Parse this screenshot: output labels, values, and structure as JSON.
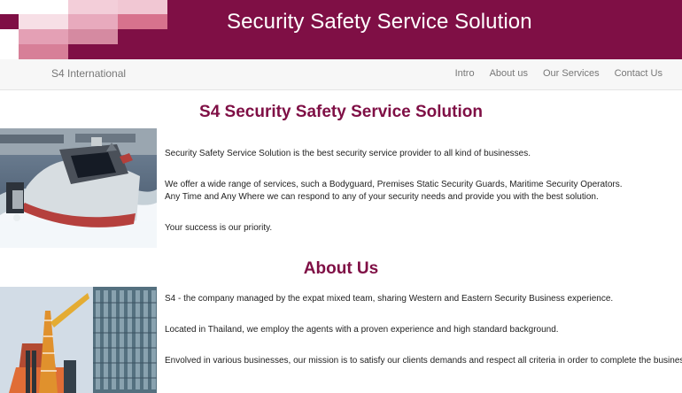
{
  "banner": {
    "title": "Security Safety Service Solution",
    "background_color": "#7f0f45",
    "logo_icon": "pink-mosaic-tiles-icon"
  },
  "navbar": {
    "brand": "S4 International",
    "links": [
      "Intro",
      "About us",
      "Our Services",
      "Contact Us"
    ]
  },
  "intro": {
    "heading": "S4 Security Safety Service Solution",
    "image": "security-boat-photo",
    "paragraphs": [
      "Security Safety Service Solution is the best security service provider to all kind of businesses.",
      "We offer a wide range of services, such a Bodyguard, Premises Static Security Guards, Maritime Security Operators.",
      "Any Time and Any Where we can respond to any of your security needs and provide you with the best solution.",
      "Your success is our priority."
    ]
  },
  "about": {
    "heading": "About Us",
    "image": "building-and-oil-rig-photo",
    "paragraphs": [
      "S4 - the company managed by the expat mixed team, sharing Western and Eastern Security Business experience.",
      "Located in Thailand, we employ the agents with a proven experience and high standard background.",
      "Envolved in various businesses, our mission is to satisfy our clients demands and respect all criteria in order to complete the business goal."
    ]
  },
  "colors": {
    "accent": "#7f0f45",
    "nav_background": "#f7f7f7",
    "body_text": "#222222",
    "nav_text": "#777777"
  }
}
